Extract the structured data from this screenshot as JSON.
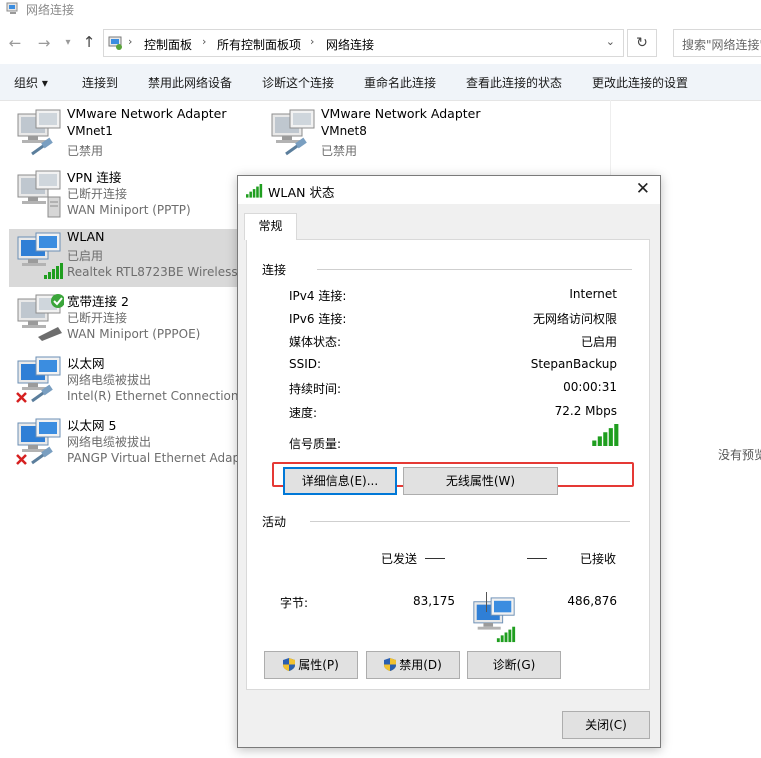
{
  "window": {
    "title": "网络连接"
  },
  "address": {
    "crumbs": [
      "控制面板",
      "所有控制面板项",
      "网络连接"
    ],
    "search_placeholder": "搜索\"网络连接\""
  },
  "commands": [
    "组织 ▾",
    "连接到",
    "禁用此网络设备",
    "诊断这个连接",
    "重命名此连接",
    "查看此连接的状态",
    "更改此连接的设置"
  ],
  "connections": [
    {
      "name": "VMware Network Adapter VMnet1",
      "line1": "VMware Network Adapter",
      "line2": "VMnet1",
      "line3": "已禁用"
    },
    {
      "name": "VMware Network Adapter VMnet8",
      "line1": "VMware Network Adapter",
      "line2": "VMnet8",
      "line3": "已禁用"
    },
    {
      "line1": "VPN 连接",
      "line2": "已断开连接",
      "line3": "WAN Miniport (PPTP)"
    },
    {
      "line1": "WLAN",
      "line2": "已启用",
      "line3": "Realtek RTL8723BE Wireless"
    },
    {
      "line1": "宽带连接 2",
      "line2": "已断开连接",
      "line3": "WAN Miniport (PPPOE)"
    },
    {
      "line1": "以太网",
      "line2": "网络电缆被拔出",
      "line3": "Intel(R) Ethernet Connection I"
    },
    {
      "line1": "以太网 5",
      "line2": "网络电缆被拔出",
      "line3": "PANGP Virtual Ethernet Adapt"
    }
  ],
  "right_pane": {
    "no_preview": "没有预览"
  },
  "dialog": {
    "title": "WLAN 状态",
    "tab": "常规",
    "connection_section": "连接",
    "rows": [
      {
        "label": "IPv4 连接:",
        "value": "Internet"
      },
      {
        "label": "IPv6 连接:",
        "value": "无网络访问权限"
      },
      {
        "label": "媒体状态:",
        "value": "已启用"
      },
      {
        "label": "SSID:",
        "value": "StepanBackup"
      },
      {
        "label": "持续时间:",
        "value": "00:00:31"
      },
      {
        "label": "速度:",
        "value": "72.2 Mbps"
      }
    ],
    "signal_label": "信号质量:",
    "details_button": "详细信息(E)...",
    "wireless_button": "无线属性(W)",
    "activity_section": "活动",
    "sent_label": "已发送",
    "received_label": "已接收",
    "bytes_label": "字节:",
    "bytes_sent": "83,175",
    "bytes_received": "486,876",
    "properties_button": "属性(P)",
    "disable_button": "禁用(D)",
    "diagnose_button": "诊断(G)",
    "close_button": "关闭(C)"
  },
  "colors": {
    "highlight_border": "#e53935",
    "accent": "#0078d7",
    "signal": "#1f9e1f"
  }
}
